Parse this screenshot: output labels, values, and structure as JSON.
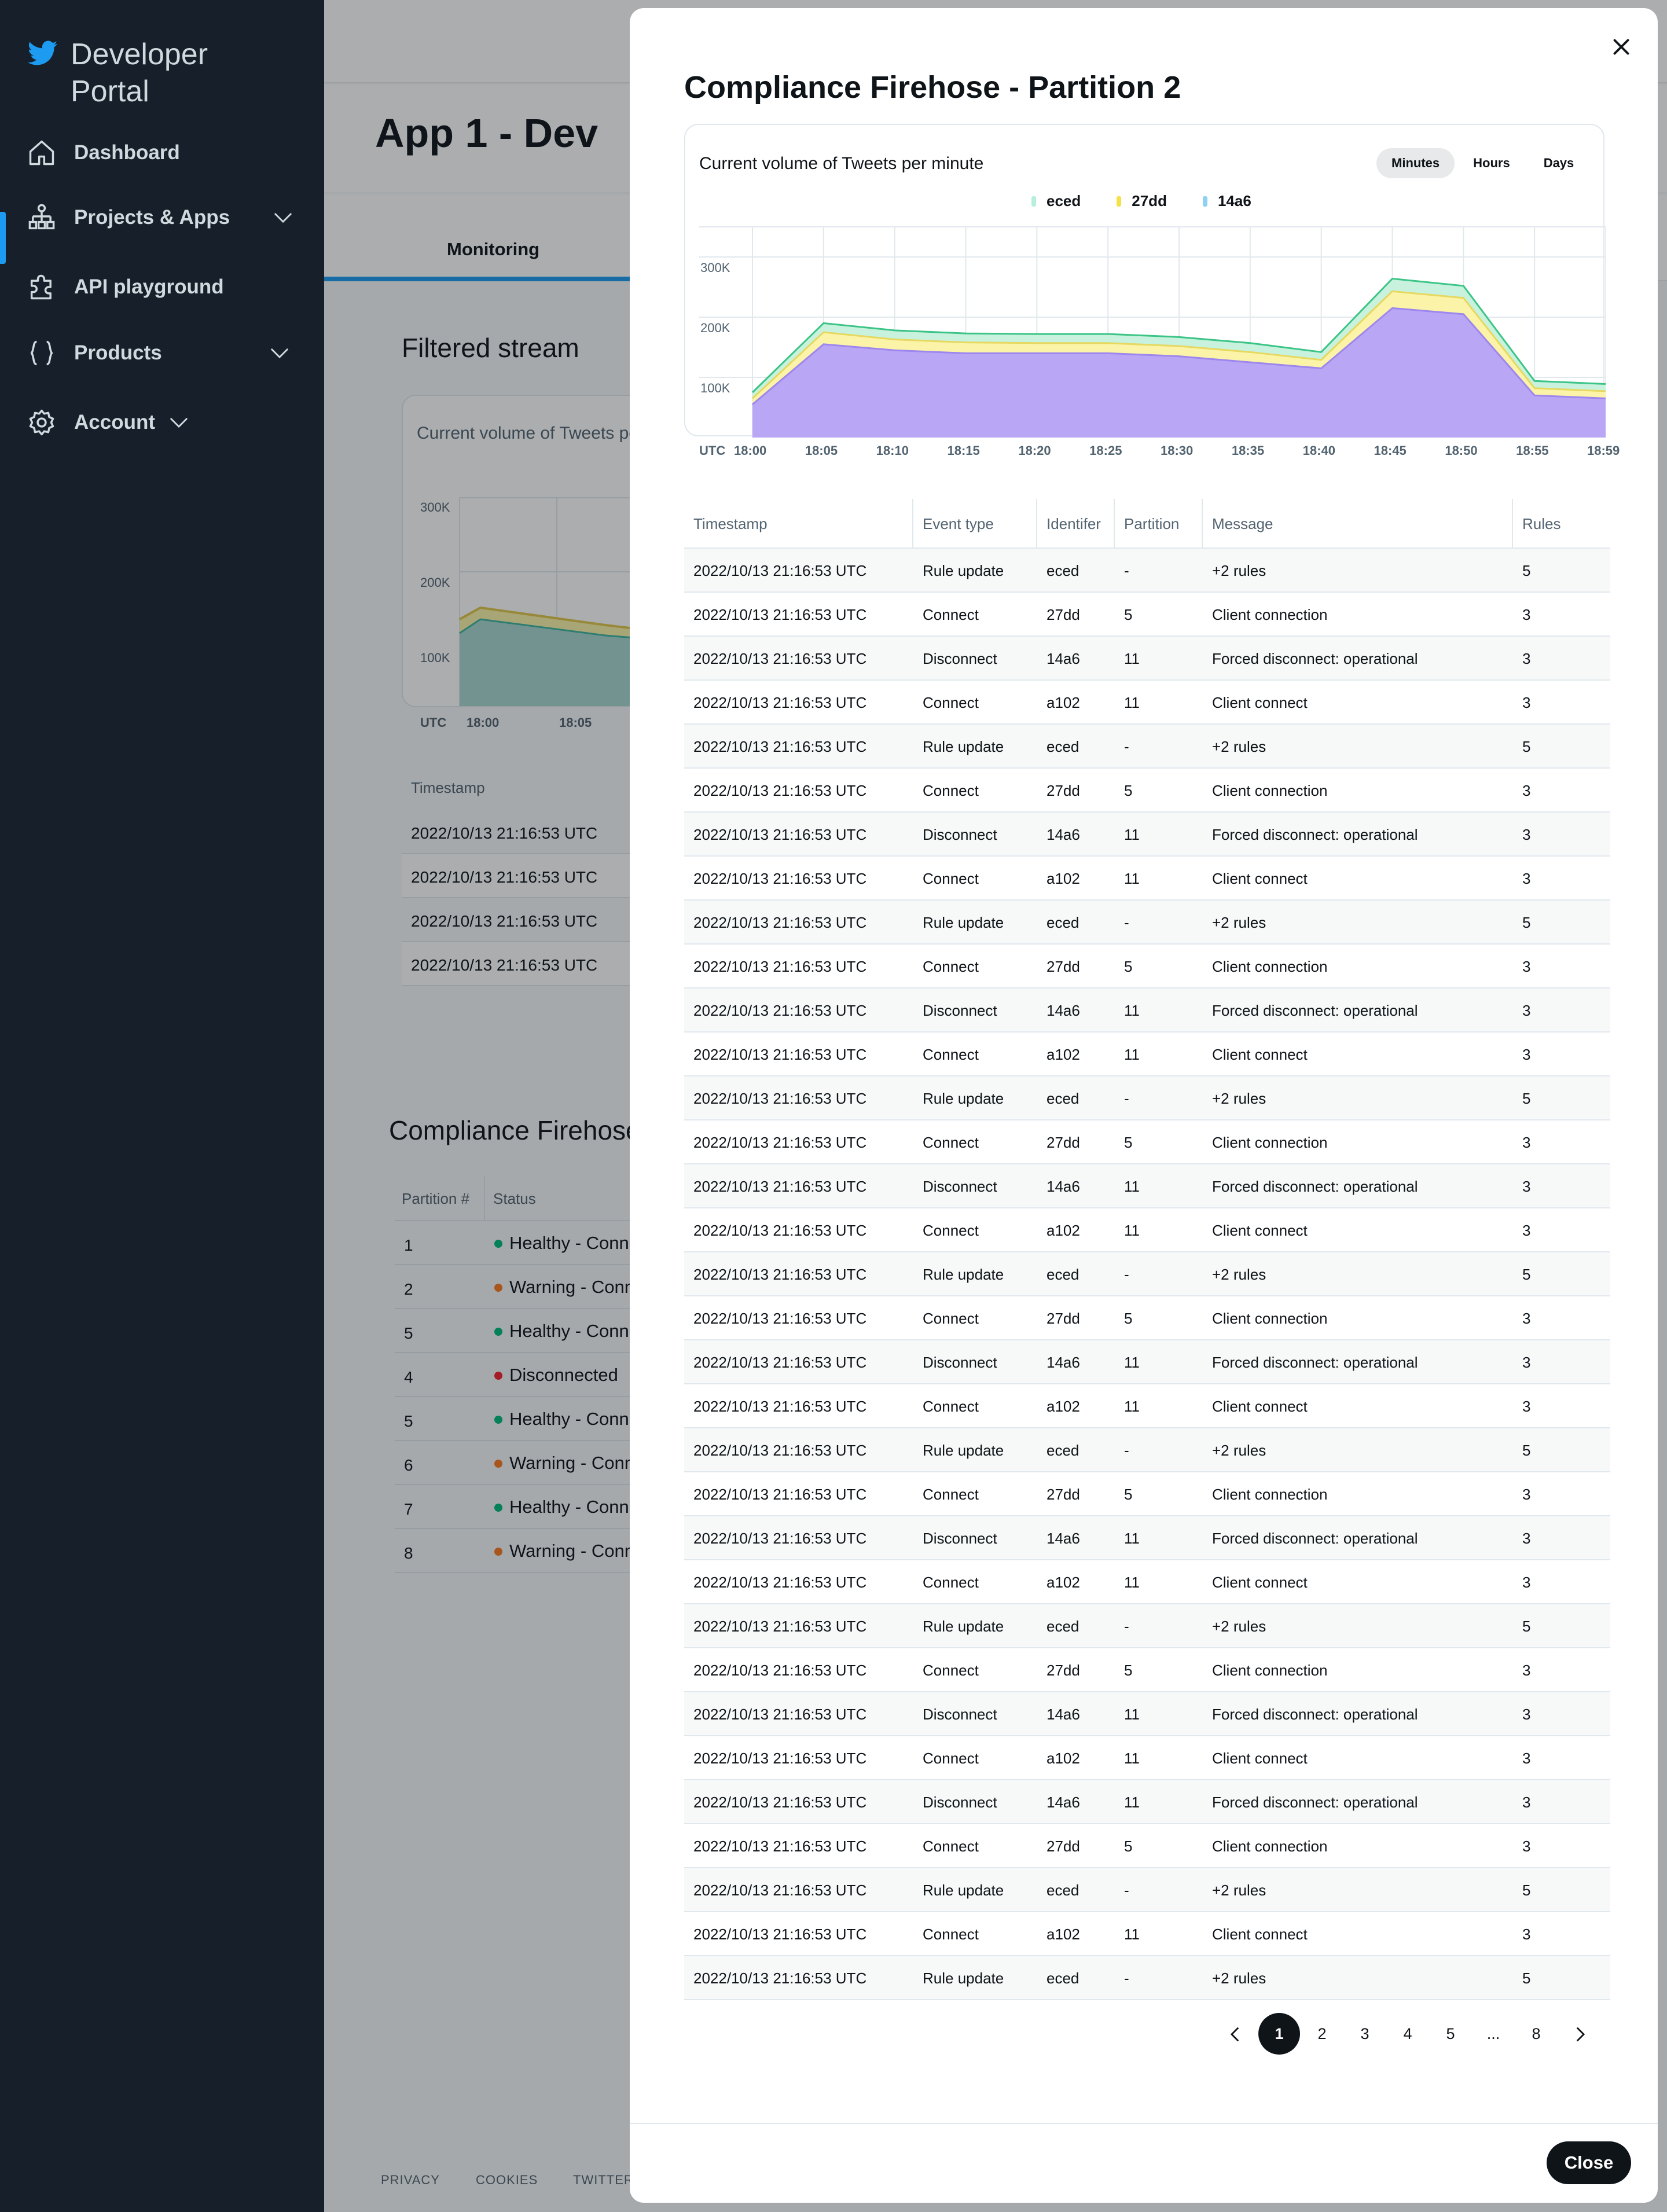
{
  "sidebar": {
    "brand": "Developer Portal",
    "items": [
      {
        "label": "Dashboard",
        "icon": "home-icon"
      },
      {
        "label": "Projects & Apps",
        "icon": "projects-icon"
      },
      {
        "label": "API playground",
        "icon": "puzzle-icon"
      },
      {
        "label": "Products",
        "icon": "braces-icon"
      },
      {
        "label": "Account",
        "icon": "gear-icon"
      }
    ]
  },
  "background": {
    "app_title": "App 1 - Dev",
    "tab": "Monitoring",
    "filtered_stream_title": "Filtered stream",
    "filtered_card_title": "Current volume of Tweets per minute",
    "y_ticks": [
      "300K",
      "200K",
      "100K"
    ],
    "x_ticks": [
      "UTC",
      "18:00",
      "18:05"
    ],
    "table_header": "Timestamp",
    "table_rows": [
      "2022/10/13 21:16:53 UTC",
      "2022/10/13 21:16:53 UTC",
      "2022/10/13 21:16:53 UTC",
      "2022/10/13 21:16:53 UTC"
    ],
    "compliance_title": "Compliance Firehose",
    "partition_headers": [
      "Partition #",
      "Status"
    ],
    "partitions": [
      {
        "num": "1",
        "status": "Healthy - Conne",
        "color": "#00ba7c"
      },
      {
        "num": "2",
        "status": "Warning - Conn",
        "color": "#f97a1f"
      },
      {
        "num": "5",
        "status": "Healthy - Conne",
        "color": "#00ba7c"
      },
      {
        "num": "4",
        "status": "Disconnected",
        "color": "#f4212e"
      },
      {
        "num": "5",
        "status": "Healthy - Conne",
        "color": "#00ba7c"
      },
      {
        "num": "6",
        "status": "Warning - Conn",
        "color": "#f97a1f"
      },
      {
        "num": "7",
        "status": "Healthy - Conne",
        "color": "#00ba7c"
      },
      {
        "num": "8",
        "status": "Warning - Conn",
        "color": "#f97a1f"
      }
    ],
    "footer_links": [
      "PRIVACY",
      "COOKIES",
      "TWITTER"
    ]
  },
  "modal": {
    "title": "Compliance Firehose - Partition 2",
    "chart_caption": "Current volume of Tweets per minute",
    "ranges": [
      "Minutes",
      "Hours",
      "Days"
    ],
    "active_range": "Minutes",
    "close_label": "Close",
    "table": {
      "columns": [
        "Timestamp",
        "Event type",
        "Identifer",
        "Partition",
        "Message",
        "Rules"
      ],
      "rows": [
        [
          "2022/10/13 21:16:53 UTC",
          "Rule update",
          "eced",
          "-",
          "+2 rules",
          "5"
        ],
        [
          "2022/10/13 21:16:53 UTC",
          "Connect",
          "27dd",
          "5",
          "Client connection",
          "3"
        ],
        [
          "2022/10/13 21:16:53 UTC",
          "Disconnect",
          "14a6",
          "11",
          "Forced disconnect: operational",
          "3"
        ],
        [
          "2022/10/13 21:16:53 UTC",
          "Connect",
          "a102",
          "11",
          "Client connect",
          "3"
        ],
        [
          "2022/10/13 21:16:53 UTC",
          "Rule update",
          "eced",
          "-",
          "+2 rules",
          "5"
        ],
        [
          "2022/10/13 21:16:53 UTC",
          "Connect",
          "27dd",
          "5",
          "Client connection",
          "3"
        ],
        [
          "2022/10/13 21:16:53 UTC",
          "Disconnect",
          "14a6",
          "11",
          "Forced disconnect: operational",
          "3"
        ],
        [
          "2022/10/13 21:16:53 UTC",
          "Connect",
          "a102",
          "11",
          "Client connect",
          "3"
        ],
        [
          "2022/10/13 21:16:53 UTC",
          "Rule update",
          "eced",
          "-",
          "+2 rules",
          "5"
        ],
        [
          "2022/10/13 21:16:53 UTC",
          "Connect",
          "27dd",
          "5",
          "Client connection",
          "3"
        ],
        [
          "2022/10/13 21:16:53 UTC",
          "Disconnect",
          "14a6",
          "11",
          "Forced disconnect: operational",
          "3"
        ],
        [
          "2022/10/13 21:16:53 UTC",
          "Connect",
          "a102",
          "11",
          "Client connect",
          "3"
        ],
        [
          "2022/10/13 21:16:53 UTC",
          "Rule update",
          "eced",
          "-",
          "+2 rules",
          "5"
        ],
        [
          "2022/10/13 21:16:53 UTC",
          "Connect",
          "27dd",
          "5",
          "Client connection",
          "3"
        ],
        [
          "2022/10/13 21:16:53 UTC",
          "Disconnect",
          "14a6",
          "11",
          "Forced disconnect: operational",
          "3"
        ],
        [
          "2022/10/13 21:16:53 UTC",
          "Connect",
          "a102",
          "11",
          "Client connect",
          "3"
        ],
        [
          "2022/10/13 21:16:53 UTC",
          "Rule update",
          "eced",
          "-",
          "+2 rules",
          "5"
        ],
        [
          "2022/10/13 21:16:53 UTC",
          "Connect",
          "27dd",
          "5",
          "Client connection",
          "3"
        ],
        [
          "2022/10/13 21:16:53 UTC",
          "Disconnect",
          "14a6",
          "11",
          "Forced disconnect: operational",
          "3"
        ],
        [
          "2022/10/13 21:16:53 UTC",
          "Connect",
          "a102",
          "11",
          "Client connect",
          "3"
        ],
        [
          "2022/10/13 21:16:53 UTC",
          "Rule update",
          "eced",
          "-",
          "+2 rules",
          "5"
        ],
        [
          "2022/10/13 21:16:53 UTC",
          "Connect",
          "27dd",
          "5",
          "Client connection",
          "3"
        ],
        [
          "2022/10/13 21:16:53 UTC",
          "Disconnect",
          "14a6",
          "11",
          "Forced disconnect: operational",
          "3"
        ],
        [
          "2022/10/13 21:16:53 UTC",
          "Connect",
          "a102",
          "11",
          "Client connect",
          "3"
        ],
        [
          "2022/10/13 21:16:53 UTC",
          "Rule update",
          "eced",
          "-",
          "+2 rules",
          "5"
        ],
        [
          "2022/10/13 21:16:53 UTC",
          "Connect",
          "27dd",
          "5",
          "Client connection",
          "3"
        ],
        [
          "2022/10/13 21:16:53 UTC",
          "Disconnect",
          "14a6",
          "11",
          "Forced disconnect: operational",
          "3"
        ],
        [
          "2022/10/13 21:16:53 UTC",
          "Connect",
          "a102",
          "11",
          "Client connect",
          "3"
        ],
        [
          "2022/10/13 21:16:53 UTC",
          "Disconnect",
          "14a6",
          "11",
          "Forced disconnect: operational",
          "3"
        ],
        [
          "2022/10/13 21:16:53 UTC",
          "Connect",
          "27dd",
          "5",
          "Client connection",
          "3"
        ],
        [
          "2022/10/13 21:16:53 UTC",
          "Rule update",
          "eced",
          "-",
          "+2 rules",
          "5"
        ],
        [
          "2022/10/13 21:16:53 UTC",
          "Connect",
          "a102",
          "11",
          "Client connect",
          "3"
        ],
        [
          "2022/10/13 21:16:53 UTC",
          "Rule update",
          "eced",
          "-",
          "+2 rules",
          "5"
        ]
      ]
    },
    "pagination": {
      "pages": [
        "1",
        "2",
        "3",
        "4",
        "5",
        "...",
        "8"
      ],
      "current": "1"
    }
  },
  "chart_data": {
    "type": "area",
    "stacked": true,
    "title": "Current volume of Tweets per minute",
    "xlabel": "UTC",
    "ylabel": "",
    "x": [
      "18:00",
      "18:05",
      "18:10",
      "18:15",
      "18:20",
      "18:25",
      "18:30",
      "18:35",
      "18:40",
      "18:45",
      "18:50",
      "18:55",
      "18:59"
    ],
    "y_ticks": [
      "300K",
      "200K",
      "100K"
    ],
    "ylim": [
      0,
      350000
    ],
    "legend_position": "top-center",
    "series": [
      {
        "name": "14a6",
        "color": "#b9a6f5",
        "values": [
          55000,
          155000,
          145000,
          140000,
          140000,
          140000,
          135000,
          125000,
          115000,
          215000,
          205000,
          70000,
          65000
        ]
      },
      {
        "name": "27dd",
        "color": "#fbf3a8",
        "values": [
          10000,
          20000,
          18000,
          18000,
          17000,
          17000,
          17000,
          17000,
          14000,
          28000,
          27000,
          12000,
          12000
        ]
      },
      {
        "name": "eced",
        "color": "#c8f2de",
        "values": [
          10000,
          15000,
          15000,
          15000,
          15000,
          15000,
          15000,
          15000,
          13000,
          21000,
          20000,
          12000,
          12000
        ]
      }
    ]
  }
}
